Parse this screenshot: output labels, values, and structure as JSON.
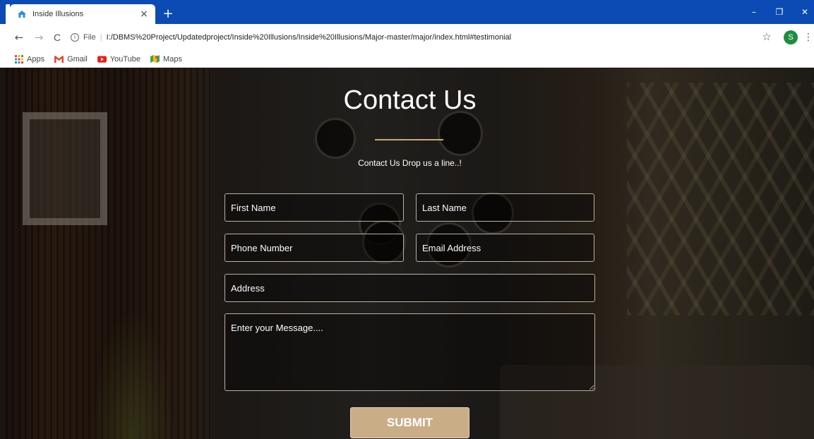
{
  "browser": {
    "tab_title": "Inside Illusions",
    "tab_close": "×",
    "new_tab": "+",
    "window": {
      "minimize": "–",
      "restore": "❐",
      "close": "✕"
    },
    "nav": {
      "back": "←",
      "forward": "→",
      "reload": "C"
    },
    "omnibox": {
      "info": "i",
      "file_label": "File",
      "separator": "|",
      "url": "I:/DBMS%20Project/Updatedproject/Inside%20Illusions/Inside%20Illusions/Major-master/major/index.html#testimonial"
    },
    "star": "☆",
    "profile_initial": "S",
    "menu": "⋮",
    "bookmarks": [
      {
        "label": "Apps",
        "icon": "apps-grid-icon"
      },
      {
        "label": "Gmail",
        "icon": "gmail-icon"
      },
      {
        "label": "YouTube",
        "icon": "youtube-icon"
      },
      {
        "label": "Maps",
        "icon": "maps-icon"
      }
    ]
  },
  "contact": {
    "heading": "Contact Us",
    "subtitle": "Contact Us  Drop us a line..!",
    "form": {
      "first_name_placeholder": "First Name",
      "last_name_placeholder": "Last Name",
      "phone_placeholder": "Phone Number",
      "email_placeholder": "Email Address",
      "address_placeholder": "Address",
      "message_placeholder": "Enter your Message....",
      "submit_label": "SUBMIT"
    }
  },
  "colors": {
    "chrome_blue": "#0b4bb3",
    "accent_gold": "#c9ad87",
    "rule_gold": "#c9a877"
  }
}
